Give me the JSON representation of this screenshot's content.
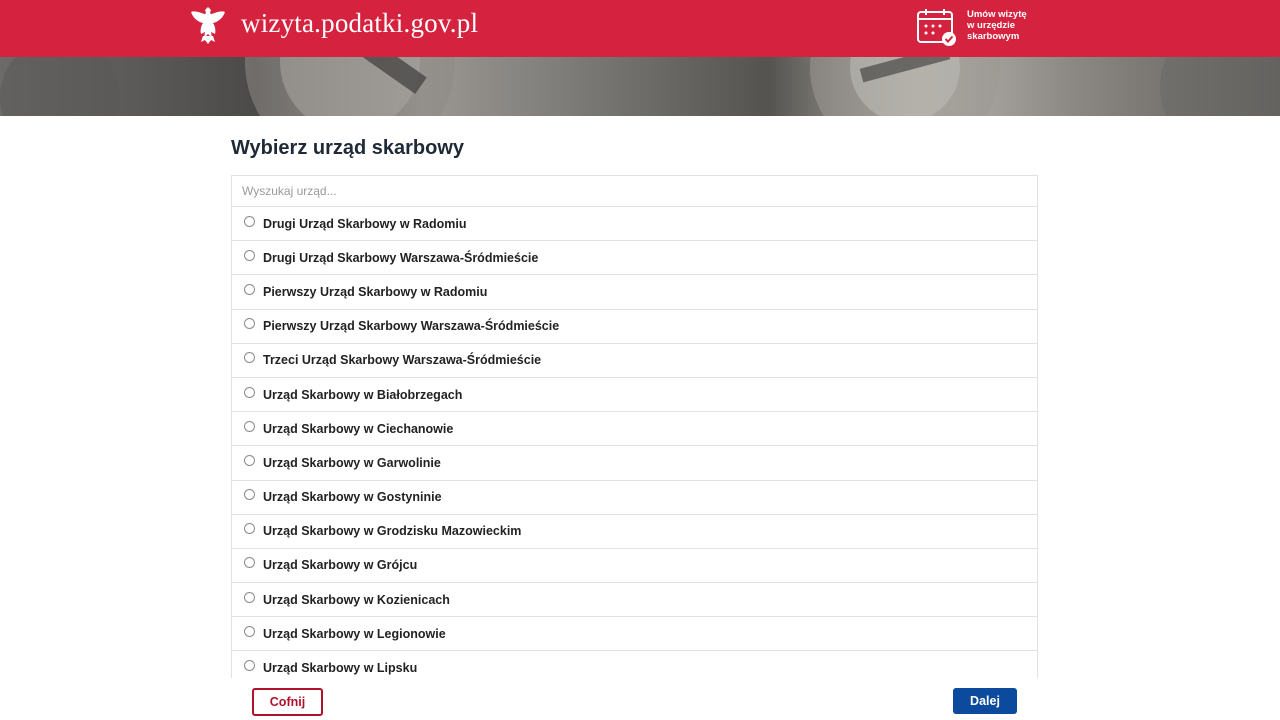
{
  "header": {
    "site_title": "wizyta.podatki.gov.pl",
    "appointment_link": {
      "lines": [
        "Umów wizytę",
        "w urzędzie",
        "skarbowym"
      ],
      "icon": "calendar-check-icon"
    },
    "logo_icon": "polish-eagle-emblem",
    "brand_color": "#d5233f"
  },
  "main": {
    "heading": "Wybierz urząd skarbowy",
    "search": {
      "placeholder": "Wyszukaj urząd...",
      "value": ""
    },
    "options": [
      {
        "label": "Drugi Urząd Skarbowy w Radomiu",
        "selected": false
      },
      {
        "label": "Drugi Urząd Skarbowy Warszawa-Śródmieście",
        "selected": false
      },
      {
        "label": "Pierwszy Urząd Skarbowy w Radomiu",
        "selected": false
      },
      {
        "label": "Pierwszy Urząd Skarbowy Warszawa-Śródmieście",
        "selected": false
      },
      {
        "label": "Trzeci Urząd Skarbowy Warszawa-Śródmieście",
        "selected": false
      },
      {
        "label": "Urząd Skarbowy w Białobrzegach",
        "selected": false
      },
      {
        "label": "Urząd Skarbowy w Ciechanowie",
        "selected": false
      },
      {
        "label": "Urząd Skarbowy w Garwolinie",
        "selected": false
      },
      {
        "label": "Urząd Skarbowy w Gostyninie",
        "selected": false
      },
      {
        "label": "Urząd Skarbowy w Grodzisku Mazowieckim",
        "selected": false
      },
      {
        "label": "Urząd Skarbowy w Grójcu",
        "selected": false
      },
      {
        "label": "Urząd Skarbowy w Kozienicach",
        "selected": false
      },
      {
        "label": "Urząd Skarbowy w Legionowie",
        "selected": false
      },
      {
        "label": "Urząd Skarbowy w Lipsku",
        "selected": false
      }
    ]
  },
  "footer": {
    "back_label": "Cofnij",
    "next_label": "Dalej",
    "back_color": "#b0122b",
    "next_color": "#0b4a9c"
  }
}
